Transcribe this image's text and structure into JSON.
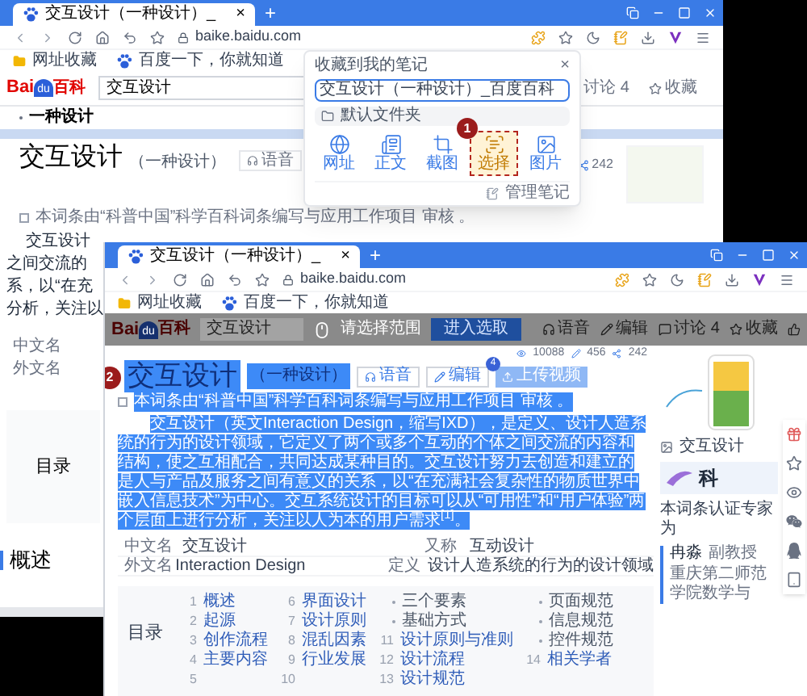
{
  "back_window": {
    "tab": {
      "title": "交互设计（一种设计）_",
      "close": "×"
    },
    "new_tab": "+",
    "address": "baike.baidu.com",
    "bookmarks": [
      "网址收藏",
      "百度一下，你就知道"
    ],
    "logo": {
      "latin": "Bai",
      "paw_text": "du",
      "chinese": "百科"
    },
    "search": "交互设计",
    "actions": [
      "讨论 4",
      "收藏"
    ],
    "breadcrumb": "一种设计",
    "title": {
      "text": "交互设计",
      "subtitle": "（一种设计）"
    },
    "title_buttons": [
      "语音"
    ],
    "stat": "242",
    "review_note": "本词条由“科普中国”科学百科词条编写与应用工作项目 审核 。",
    "paragraph_fragments": [
      "交互设计",
      "之间交流的",
      "系，以“在充",
      "分析，关注以"
    ],
    "info_labels": [
      "中文名",
      "外文名"
    ],
    "contents_heading": "目录",
    "section_heading": "概述"
  },
  "note_popup": {
    "title": "收藏到我的笔记",
    "close": "×",
    "name_value": "交互设计（一种设计）_百度百科",
    "folder": "默认文件夹",
    "modes": [
      {
        "kind": "web",
        "label": "网址",
        "selected": false
      },
      {
        "kind": "text",
        "label": "正文",
        "selected": false
      },
      {
        "kind": "crop",
        "label": "截图",
        "selected": false
      },
      {
        "kind": "select",
        "label": "选择",
        "selected": true
      },
      {
        "kind": "image",
        "label": "图片",
        "selected": false
      }
    ],
    "step_badge": "1",
    "manage": "管理笔记"
  },
  "front_window": {
    "tab": {
      "title": "交互设计（一种设计）_",
      "close": "×"
    },
    "new_tab": "+",
    "address": "baike.baidu.com",
    "bookmarks": [
      "网址收藏",
      "百度一下，你就知道"
    ],
    "logo": {
      "latin": "Bai",
      "paw_text": "du",
      "chinese": "百科"
    },
    "search": "交互设计",
    "select_hint": "请选择范围",
    "select_button": "进入选取",
    "actions": [
      {
        "kind": "voice",
        "label": "语音"
      },
      {
        "kind": "edit",
        "label": "编辑"
      },
      {
        "kind": "discuss",
        "label": "讨论 4"
      },
      {
        "kind": "favorite",
        "label": "收藏"
      }
    ],
    "stats": [
      "10088",
      "456",
      "242"
    ],
    "title": {
      "text": "交互设计",
      "subtitle": "（一种设计）",
      "highlighted": true
    },
    "step_badge": "2",
    "title_buttons": [
      {
        "kind": "voice",
        "label": "语音"
      },
      {
        "kind": "edit",
        "label": "编辑"
      }
    ],
    "count_badge": "4",
    "upload_button": "上传视频",
    "review_note": {
      "text": "本词条由“科普中国”科学百科词条编写与应用工作项目 审核 。",
      "highlighted": true
    },
    "paragraph": {
      "text": "交互设计（英文Interaction Design，缩写IXD），是定义、设计人造系统的行为的设计领域，它定义了两个或多个互动的个体之间交流的内容和结构，使之互相配合，共同达成某种目的。交互设计努力去创造和建立的是人与产品及服务之间有意义的关系，以“在充满社会复杂性的物质世界中嵌入信息技术”为中心。交互系统设计的目标可以从“可用性”和“用户体验”两个层面上进行分析，关注以人为本的用户需求$^{[1]}$。",
      "highlighted": true
    },
    "info_rows": [
      {
        "label": "中文名",
        "value": "交互设计",
        "label2": "又称",
        "value2": "互动设计"
      },
      {
        "label": "外文名",
        "value": "Interaction Design",
        "label2": "定义",
        "value2": "设计人造系统的行为的设计领域"
      }
    ],
    "contents": {
      "heading": "目录",
      "columns": [
        [
          {
            "kind": "item",
            "number": "1",
            "label": "概述"
          },
          {
            "kind": "item",
            "number": "2",
            "label": "起源"
          },
          {
            "kind": "item",
            "number": "3",
            "label": "创作流程"
          },
          {
            "kind": "item",
            "number": "4",
            "label": "主要内容"
          },
          {
            "kind": "item",
            "number": "5"
          }
        ],
        [
          {
            "kind": "item",
            "number": "6",
            "label": "界面设计"
          },
          {
            "kind": "item",
            "number": "7",
            "label": "设计原则"
          },
          {
            "kind": "item",
            "number": "8",
            "label": "混乱因素"
          },
          {
            "kind": "item",
            "number": "9",
            "label": "行业发展"
          },
          {
            "kind": "item",
            "number": "10"
          }
        ],
        [
          {
            "kind": "sub",
            "label": "三个要素"
          },
          {
            "kind": "sub",
            "label": "基础方式"
          },
          {
            "kind": "item",
            "number": "11",
            "label": "设计原则与准则"
          },
          {
            "kind": "item",
            "number": "12",
            "label": "设计流程"
          },
          {
            "kind": "item",
            "number": "13",
            "label": "设计规范"
          }
        ],
        [
          {
            "kind": "sub",
            "label": "页面规范"
          },
          {
            "kind": "sub",
            "label": "信息规范"
          },
          {
            "kind": "sub",
            "label": "控件规范"
          },
          {
            "kind": "item",
            "number": "14",
            "label": "相关学者"
          }
        ]
      ]
    },
    "side_caption": "交互设计",
    "side_card_title": "科",
    "expert_heading": "本词条认证专家为",
    "expert_name": "冉淼",
    "expert_title": "副教授",
    "expert_org": "重庆第二师范学院数学与"
  }
}
